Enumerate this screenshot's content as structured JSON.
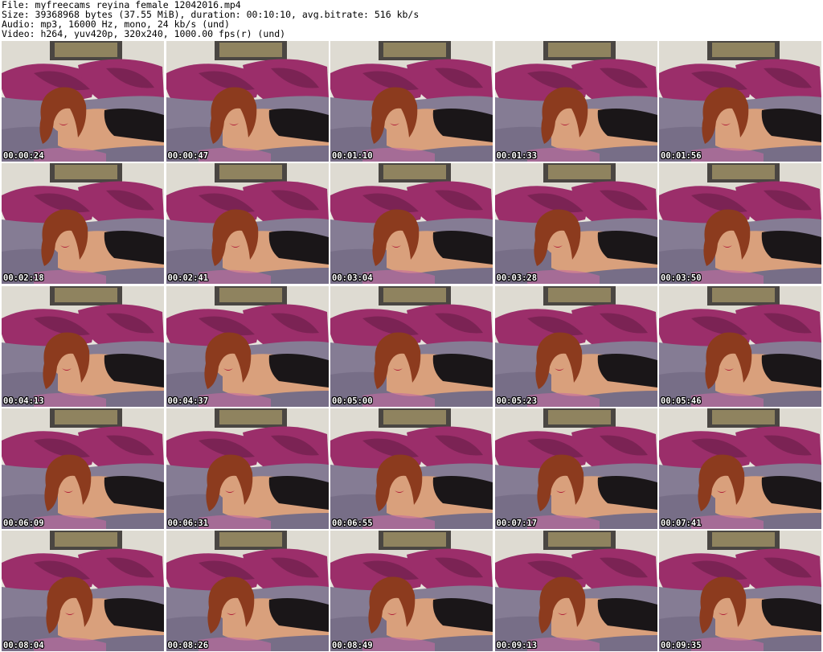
{
  "header": {
    "file": "File: myfreecams_reyina_female_12042016.mp4",
    "size": "Size: 39368968 bytes (37.55 MiB), duration: 00:10:10, avg.bitrate: 516 kb/s",
    "audio": "Audio: mp3, 16000 Hz, mono, 24 kb/s (und)",
    "video": "Video: h264, yuv420p, 320x240, 1000.00 fps(r) (und)"
  },
  "thumbnails": [
    {
      "timestamp": "00:00:24"
    },
    {
      "timestamp": "00:00:47"
    },
    {
      "timestamp": "00:01:10"
    },
    {
      "timestamp": "00:01:33"
    },
    {
      "timestamp": "00:01:56"
    },
    {
      "timestamp": "00:02:18"
    },
    {
      "timestamp": "00:02:41"
    },
    {
      "timestamp": "00:03:04"
    },
    {
      "timestamp": "00:03:28"
    },
    {
      "timestamp": "00:03:50"
    },
    {
      "timestamp": "00:04:13"
    },
    {
      "timestamp": "00:04:37"
    },
    {
      "timestamp": "00:05:00"
    },
    {
      "timestamp": "00:05:23"
    },
    {
      "timestamp": "00:05:46"
    },
    {
      "timestamp": "00:06:09"
    },
    {
      "timestamp": "00:06:31"
    },
    {
      "timestamp": "00:06:55"
    },
    {
      "timestamp": "00:07:17"
    },
    {
      "timestamp": "00:07:41"
    },
    {
      "timestamp": "00:08:04"
    },
    {
      "timestamp": "00:08:26"
    },
    {
      "timestamp": "00:08:49"
    },
    {
      "timestamp": "00:09:13"
    },
    {
      "timestamp": "00:09:35"
    }
  ],
  "colors": {
    "wall": "#e6e4dc",
    "headboard": "#4a4642",
    "pillow": "#9b2e6a",
    "pillow_dark": "#6e1f4c",
    "blanket": "#857c94",
    "hair": "#8c3b1e",
    "skin": "#d9a07c",
    "clothing": "#1a1618",
    "timestamp_text": "#ffffff"
  }
}
